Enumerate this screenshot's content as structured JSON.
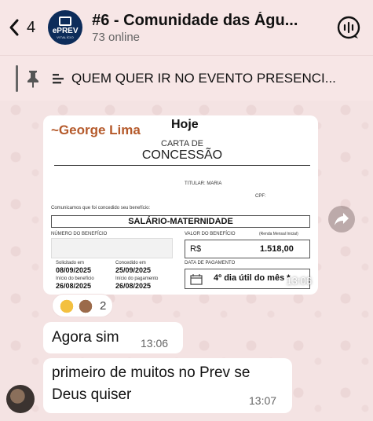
{
  "header": {
    "back_count": "4",
    "avatar_logo_text": "ePREV",
    "avatar_logo_sub": "VITALÍCIO",
    "title": "#6 - Comunidade das Águ...",
    "subtitle": "73 online"
  },
  "pinned": {
    "text": "QUEM QUER IR NO EVENTO PRESENCI..."
  },
  "day_chip": "Hoje",
  "image_message": {
    "sender": "~George Lima",
    "doc_header": "CARTA DE",
    "doc_title": "CONCESSÃO",
    "titular_label": "TITULAR: MARIA",
    "cpf_label": "CPF:",
    "comunicamos": "Comunicamos que foi concedido seu benefício:",
    "benefit": "SALÁRIO-MATERNIDADE",
    "numero_label": "NÚMERO DO BENEFÍCIO",
    "valor_label": "VALOR DO BENEFÍCIO",
    "renda_label": "(Renda Mensal Inicial)",
    "currency": "R$",
    "valor": "1.518,00",
    "solicitado_label": "Solicitado em",
    "solicitado": "08/09/2025",
    "concedido_label": "Concedido em",
    "concedido": "25/09/2025",
    "inicio_beneficio_label": "Início do benefício",
    "inicio_beneficio": "26/08/2025",
    "inicio_pagamento_label": "Início do pagamento",
    "inicio_pagamento": "26/08/2025",
    "data_pagamento_label": "DATA DE PAGAMENTO",
    "data_pagamento": "4º dia útil do mês *",
    "time": "13:06"
  },
  "reactions": {
    "count": "2"
  },
  "messages": [
    {
      "text": "Agora sim",
      "time": "13:06"
    },
    {
      "text_line1": "primeiro de muitos no Prev se",
      "text_line2": "Deus quiser",
      "time": "13:07"
    }
  ],
  "colors": {
    "background": "#f4e3e3",
    "sender_name": "#b55a2b",
    "group_avatar": "#0d2c5a"
  }
}
